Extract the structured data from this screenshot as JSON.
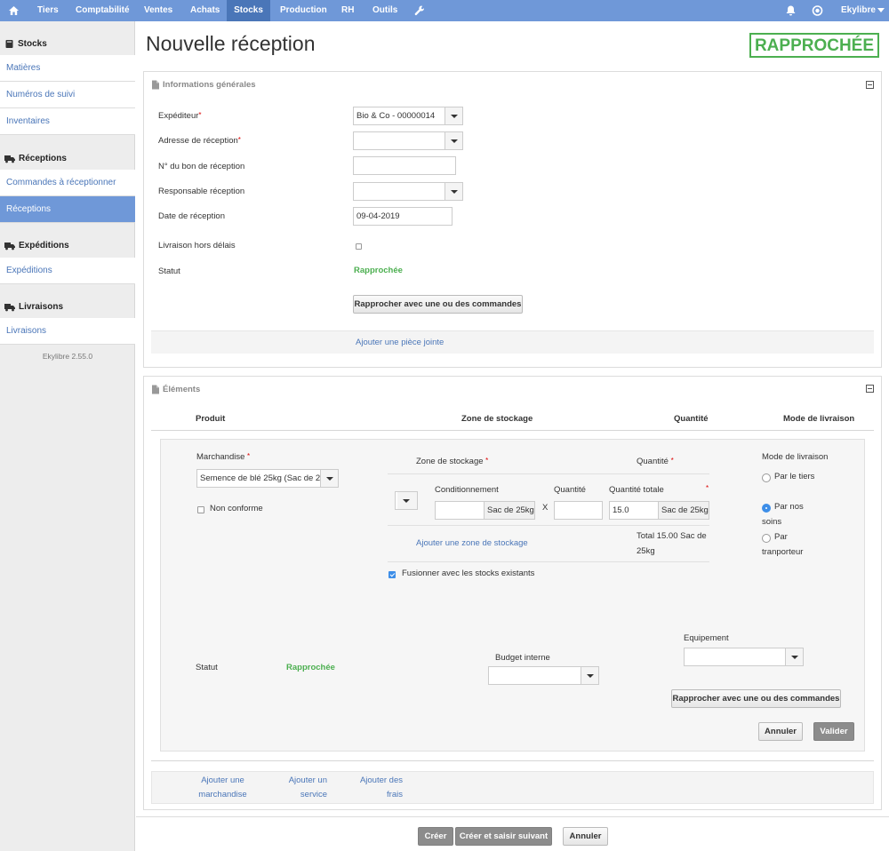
{
  "nav": {
    "items": [
      "Tiers",
      "Comptabilité",
      "Ventes",
      "Achats",
      "Stocks",
      "Production",
      "RH",
      "Outils"
    ],
    "active": "Stocks",
    "user": "Ekylibre",
    "icons": [
      "home-icon",
      "wrench-icon",
      "bell-icon",
      "globe-icon",
      "caret-down-icon"
    ]
  },
  "sidebar": {
    "sections": [
      {
        "title": "Stocks",
        "links": [
          "Matières",
          "Numéros de suivi",
          "Inventaires"
        ]
      },
      {
        "title": "Réceptions",
        "links": [
          "Commandes à réceptionner",
          "Réceptions"
        ]
      },
      {
        "title": "Expéditions",
        "links": [
          "Expéditions"
        ]
      },
      {
        "title": "Livraisons",
        "links": [
          "Livraisons"
        ]
      }
    ],
    "active_link": "Réceptions",
    "version": "Ekylibre 2.55.0"
  },
  "page": {
    "title": "Nouvelle réception",
    "status_badge": "RAPPROCHÉE",
    "status_color": "#4caf50"
  },
  "general": {
    "title": "Informations générales",
    "fields": {
      "sender": {
        "label": "Expéditeur",
        "value": "Bio & Co - 00000014"
      },
      "address": {
        "label": "Adresse de réception",
        "value": ""
      },
      "number": {
        "label": "N° du bon de réception",
        "value": ""
      },
      "responsible": {
        "label": "Responsable réception",
        "value": ""
      },
      "date": {
        "label": "Date de réception",
        "value": "09-04-2019"
      },
      "late": {
        "label": "Livraison hors délais"
      },
      "status": {
        "label": "Statut",
        "value": "Rapprochée"
      }
    },
    "match_button": "Rapprocher avec une ou des commandes",
    "attachment_link": "Ajouter une pièce jointe"
  },
  "elements": {
    "title": "Éléments",
    "headers": {
      "product": "Produit",
      "zone": "Zone de stockage",
      "quantity": "Quantité",
      "delivery": "Mode de livraison"
    },
    "item": {
      "merch_label": "Marchandise",
      "merch_value": "Semence de blé 25kg (Sac de 25",
      "non_conforme": "Non conforme",
      "zone_label": "Zone de stockage",
      "qty_label": "Quantité",
      "cond_label": "Conditionnement",
      "qty_col": "Quantité",
      "total_qty_label": "Quantité totale",
      "unit": "Sac de 25kg",
      "times": "X",
      "total_qty_value": "15.0",
      "total_text": "Total   15.00 Sac de 25kg",
      "add_zone": "Ajouter une zone de stockage",
      "merge": "Fusionner avec les stocks existants",
      "delivery_label": "Mode de livraison",
      "delivery_options": [
        "Par le tiers",
        "Par nos soins",
        "Par tranporteur"
      ],
      "delivery_selected": "Par nos soins",
      "status_label": "Statut",
      "status_value": "Rapprochée",
      "budget_label": "Budget interne",
      "equipment_label": "Equipement",
      "match_button": "Rapprocher avec une ou des commandes",
      "cancel": "Annuler",
      "validate": "Valider"
    },
    "add_links": [
      "Ajouter une marchandise",
      "Ajouter un service",
      "Ajouter des frais"
    ]
  },
  "footer": {
    "create": "Créer",
    "create_next": "Créer et saisir suivant",
    "cancel": "Annuler"
  }
}
